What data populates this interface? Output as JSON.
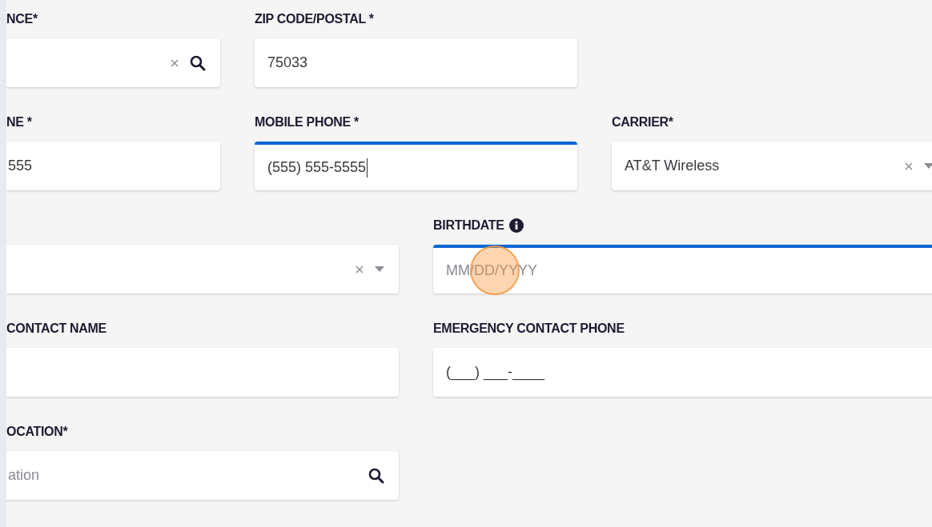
{
  "rows": [
    {
      "fields": [
        {
          "label": "NCE*",
          "kind": "search",
          "clearable": true,
          "focused": false
        },
        {
          "label": "ZIP CODE/POSTAL *",
          "kind": "text",
          "value": "75033",
          "focused": false
        }
      ]
    },
    {
      "fields": [
        {
          "label": "NE *",
          "kind": "text",
          "value": "555",
          "focused": false
        },
        {
          "label": "MOBILE PHONE *",
          "kind": "text",
          "value": "(555) 555-5555",
          "focused": true
        },
        {
          "label": "CARRIER*",
          "kind": "select",
          "value": "AT&T Wireless",
          "clearable": true,
          "focused": false
        }
      ]
    },
    {
      "fields": [
        {
          "kind": "select",
          "clearable": true,
          "focused": false
        },
        {
          "label": "BIRTHDATE",
          "kind": "text",
          "placeholder": "MM/DD/YYYY",
          "info": true,
          "focused": true,
          "clicked": true
        }
      ]
    },
    {
      "fields": [
        {
          "label": "CONTACT NAME",
          "kind": "text",
          "focused": false
        },
        {
          "label": "EMERGENCY CONTACT PHONE",
          "kind": "text",
          "value": "(___) ___-____",
          "focused": false
        }
      ]
    },
    {
      "fields": [
        {
          "label": "OCATION*",
          "kind": "search",
          "placeholder": "ation",
          "focused": false
        }
      ]
    }
  ]
}
